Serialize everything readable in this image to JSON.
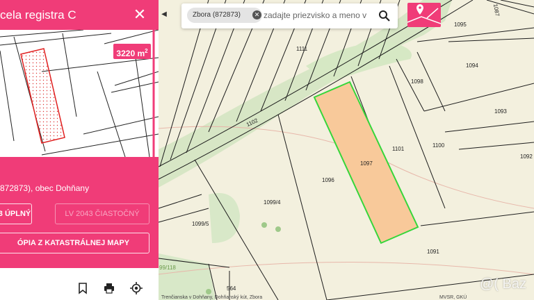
{
  "panel": {
    "title": "cela registra C",
    "close_label": "✕",
    "area_value": "3220 m",
    "area_sup": "2",
    "location": "872873), obec Dohňany",
    "lv_full_label": "3 ÚPLNÝ",
    "lv_partial_label": "LV 2043 ČIASTOČNÝ",
    "copy_label": "ÓPIA Z KATASTRÁLNEJ MAPY",
    "icons": [
      "bookmark-icon",
      "print-icon",
      "locate-icon"
    ]
  },
  "search": {
    "chip_label": "Zbora (872873)",
    "chip_remove": "✕",
    "placeholder": "zadajte priezvisko a meno v",
    "collapse_label": "◀"
  },
  "map": {
    "parcels": [
      "1111",
      "1102",
      "1095",
      "1094",
      "1098",
      "1093",
      "1092",
      "1101",
      "1100",
      "1097",
      "1096",
      "1099/4",
      "1099/5",
      "1091",
      "564",
      "99/118",
      "1087"
    ],
    "highlight_fill": "#f8c99a",
    "highlight_stroke": "#35d63a",
    "road_color": "#c4deb0"
  },
  "footer": {
    "left": "Trenčianska v Dohňany, Dohňanský kút, Zbora",
    "right": "MVSR, GKÚ"
  },
  "watermark": "@( Baz",
  "colors": {
    "brand": "#f03c78",
    "panel_bg": "#ffffff"
  }
}
